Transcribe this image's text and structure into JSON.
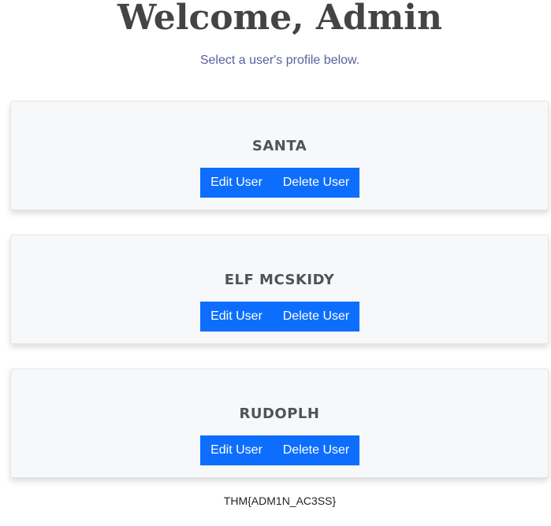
{
  "header": {
    "title": "Welcome, Admin",
    "subtitle": "Select a user's profile below."
  },
  "users": [
    {
      "name": "SANTA",
      "edit_label": "Edit User",
      "delete_label": "Delete User"
    },
    {
      "name": "ELF MCSKIDY",
      "edit_label": "Edit User",
      "delete_label": "Delete User"
    },
    {
      "name": "RUDOPLH",
      "edit_label": "Edit User",
      "delete_label": "Delete User"
    }
  ],
  "footer": {
    "flag": "THM{ADM1N_AC3SS}"
  },
  "colors": {
    "button_bg": "#0d6efd",
    "card_bg": "#f7f8fa",
    "title": "#444444",
    "subtitle": "#5a5f9e"
  }
}
